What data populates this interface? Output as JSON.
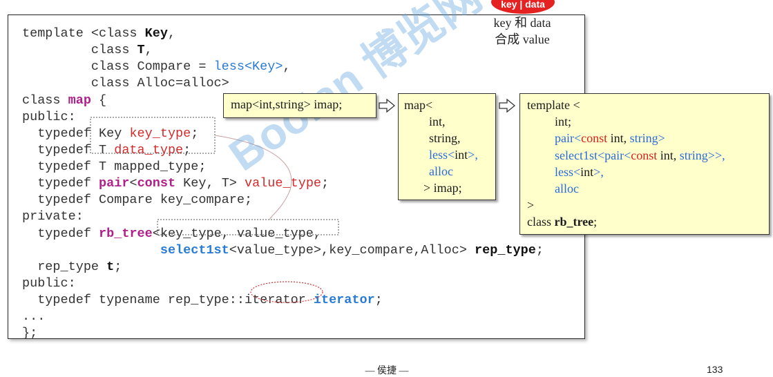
{
  "badge": {
    "text": "key | data"
  },
  "note": {
    "line1": "key 和 data",
    "line2": "合成 value"
  },
  "code": {
    "l1": {
      "a": "template <class ",
      "b": "Key",
      "c": ","
    },
    "l2": {
      "a": "         class ",
      "b": "T",
      "c": ","
    },
    "l3": {
      "a": "         class Compare = ",
      "b": "less<Key>",
      "c": ","
    },
    "l4": {
      "a": "         class Alloc=alloc>"
    },
    "l5": {
      "a": "class ",
      "b": "map",
      "c": " {"
    },
    "l6": {
      "a": "public:"
    },
    "l7": {
      "a": "  typedef Key ",
      "b": "key_type",
      "c": ";"
    },
    "l8": {
      "a": "  typedef T ",
      "b": "data_type",
      "c": ";"
    },
    "l9": {
      "a": "  typedef T mapped_type;"
    },
    "l10": {
      "a": "  typedef ",
      "b": "pair",
      "c": "<",
      "d": "const",
      "e": " Key, T> ",
      "f": "value_type",
      "g": ";"
    },
    "l11": {
      "a": "  typedef Compare key_compare;"
    },
    "l12": {
      "a": "private:"
    },
    "l13": {
      "a": "  typedef ",
      "b": "rb_tree",
      "c": "<key_type, value_type,"
    },
    "l14": {
      "a": "                  ",
      "b": "select1st",
      "c": "<value_type>,key_compare,Alloc> ",
      "d": "rep_type",
      "e": ";"
    },
    "l15": {
      "a": "  rep_type ",
      "b": "t",
      "c": ";"
    },
    "l16": {
      "a": "public:"
    },
    "l17": {
      "a": "  typedef typename rep_type::iterator ",
      "b": "iterator",
      "c": ";"
    },
    "l18": {
      "a": "..."
    },
    "l19": {
      "a": "};"
    }
  },
  "box1": {
    "text": "map<int,string> imap;"
  },
  "box2": {
    "l1": "map<",
    "l2": "int,",
    "l3": "string,",
    "l4a": "less<",
    "l4b": "int",
    "l4c": ">,",
    "l5": "alloc",
    "l6": "> imap;"
  },
  "box3": {
    "l1": "template <",
    "l2": "int;",
    "l3a": "pair<",
    "l3b": "const",
    "l3c": " int, ",
    "l3d": "string>",
    "l4a": "select1st<",
    "l4b": "pair<",
    "l4c": "const",
    "l4d": " int, ",
    "l4e": "string>>,",
    "l5a": "less<",
    "l5b": "int",
    "l5c": ">,",
    "l6": "alloc",
    "l7": ">",
    "l8a": "class ",
    "l8b": "rb_tree",
    "l8c": ";"
  },
  "watermark": {
    "text": "Boolan 博览网"
  },
  "footer": {
    "center": "— 侯捷 —",
    "page": "133"
  },
  "colors": {
    "code_text": "#333333",
    "keyword": "#b0208a",
    "red": "#d32b2b",
    "blue": "#2a7bd4",
    "callout_bg": "#ffffcc",
    "badge": "#e42222"
  }
}
